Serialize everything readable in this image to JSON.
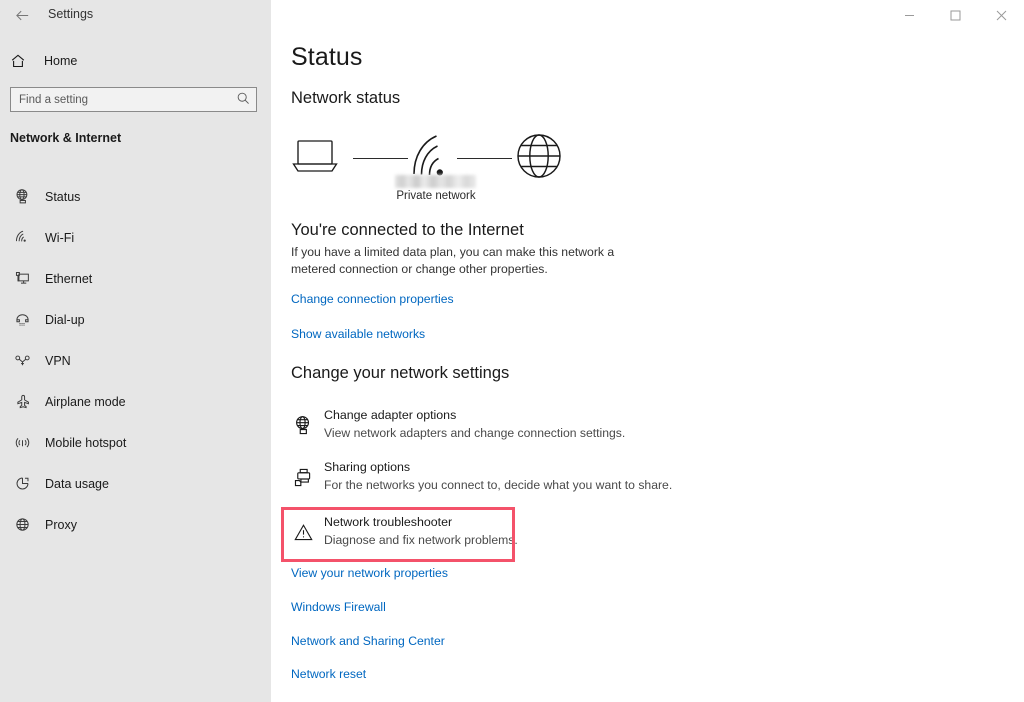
{
  "titlebar": {
    "back_icon": "back-arrow-icon",
    "title": "Settings",
    "minimize_label": "Minimize",
    "maximize_label": "Maximize",
    "close_label": "Close"
  },
  "sidebar": {
    "home": {
      "label": "Home",
      "icon": "home-icon"
    },
    "search": {
      "placeholder": "Find a setting",
      "value": "",
      "icon": "search-icon"
    },
    "category": "Network & Internet",
    "items": [
      {
        "label": "Status",
        "icon": "globe-monitor-icon",
        "selected": true
      },
      {
        "label": "Wi-Fi",
        "icon": "wifi-icon",
        "selected": false
      },
      {
        "label": "Ethernet",
        "icon": "monitor-icon",
        "selected": false
      },
      {
        "label": "Dial-up",
        "icon": "phone-icon",
        "selected": false
      },
      {
        "label": "VPN",
        "icon": "vpn-key-icon",
        "selected": false
      },
      {
        "label": "Airplane mode",
        "icon": "airplane-icon",
        "selected": false
      },
      {
        "label": "Mobile hotspot",
        "icon": "broadcast-icon",
        "selected": false
      },
      {
        "label": "Data usage",
        "icon": "pie-chart-icon",
        "selected": false
      },
      {
        "label": "Proxy",
        "icon": "globe-icon",
        "selected": false
      }
    ]
  },
  "main": {
    "page_title": "Status",
    "network_status_heading": "Network status",
    "diagram": {
      "device_icon": "laptop-icon",
      "network_icon": "wifi-signal-icon",
      "internet_icon": "globe-icon",
      "ssid_redacted": true,
      "network_type_label": "Private network"
    },
    "connected_title": "You're connected to the Internet",
    "connected_desc": "If you have a limited data plan, you can make this network a metered connection or change other properties.",
    "links_top": [
      {
        "label": "Change connection properties"
      },
      {
        "label": "Show available networks"
      }
    ],
    "change_settings_heading": "Change your network settings",
    "settings": [
      {
        "title": "Change adapter options",
        "subtitle": "View network adapters and change connection settings.",
        "icon": "network-adapter-icon",
        "highlighted": false
      },
      {
        "title": "Sharing options",
        "subtitle": "For the networks you connect to, decide what you want to share.",
        "icon": "sharing-icon",
        "highlighted": false
      },
      {
        "title": "Network troubleshooter",
        "subtitle": "Diagnose and fix network problems.",
        "icon": "warning-triangle-icon",
        "highlighted": true
      }
    ],
    "links_bottom": [
      {
        "label": "View your network properties"
      },
      {
        "label": "Windows Firewall"
      },
      {
        "label": "Network and Sharing Center"
      },
      {
        "label": "Network reset"
      }
    ]
  },
  "colors": {
    "accent_link": "#0067c0",
    "highlight_border": "#f4526a",
    "sidebar_bg": "#e6e6e6",
    "content_bg": "#ffffff",
    "text_primary": "#1a1a1a"
  }
}
